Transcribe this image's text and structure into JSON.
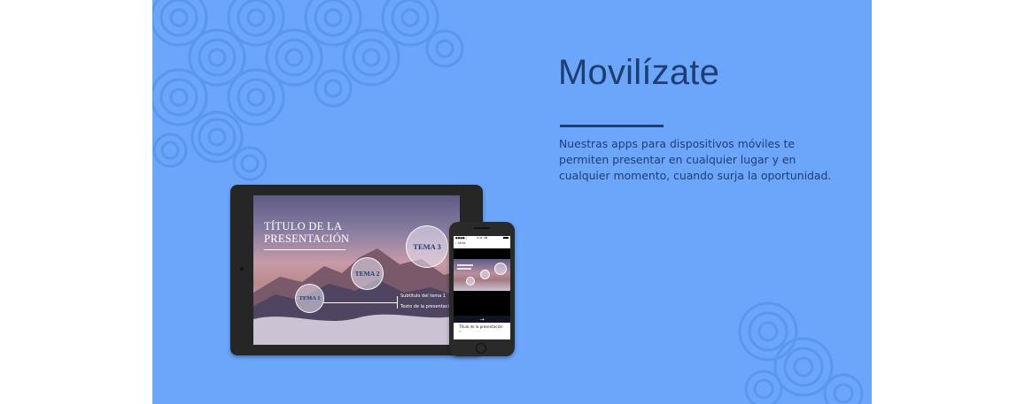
{
  "hero": {
    "title": "Movilízate",
    "description": "Nuestras apps para dispositivos móviles te permiten presentar en cualquier lugar y en cualquier momento, cuando surja la oportunidad.",
    "accent_color": "#1f3d73",
    "background_color": "#6ba6fb"
  },
  "tablet_slide": {
    "title_line1": "TÍTULO DE LA",
    "title_line2": "PRESENTACIÓN",
    "topics": [
      "TEMA 1",
      "TEMA 2",
      "TEMA 3"
    ],
    "notes": [
      "Subtítulo del tema 1",
      "Texto de la presentación"
    ]
  },
  "phone_screen": {
    "status_left": "●●●●○",
    "status_time": "9:41 AM",
    "back_label": "‹ Atrás",
    "nav_arrow": "→",
    "caption": "Título de la presentación",
    "subcaption": "Tú"
  }
}
